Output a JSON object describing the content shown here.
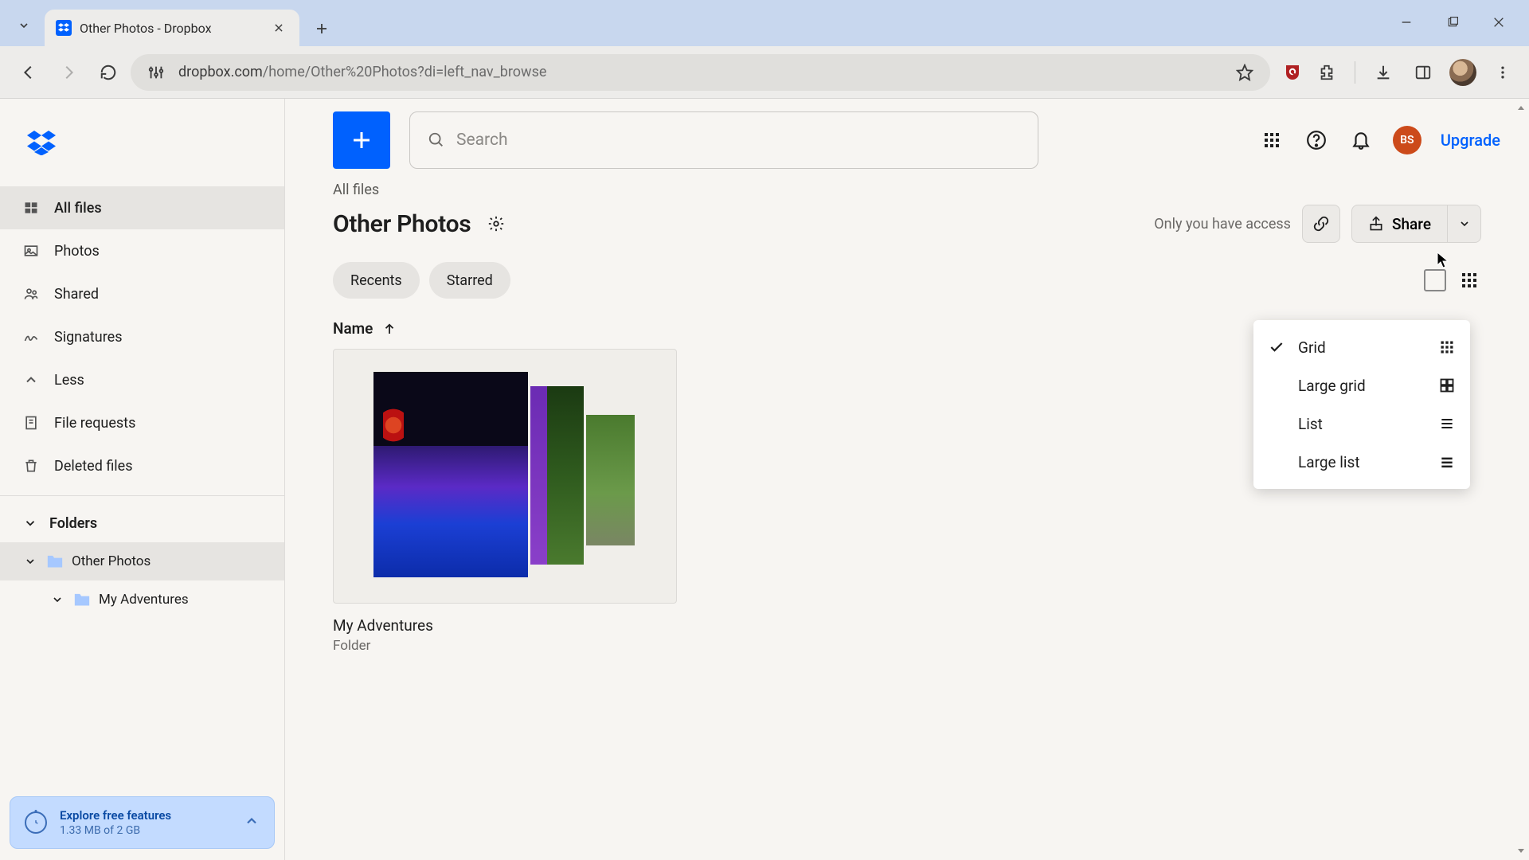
{
  "browser": {
    "tab_title": "Other Photos - Dropbox",
    "url_host": "dropbox.com",
    "url_path": "/home/Other%20Photos?di=left_nav_browse"
  },
  "sidebar": {
    "nav": [
      {
        "id": "all-files",
        "label": "All files",
        "active": true
      },
      {
        "id": "photos",
        "label": "Photos"
      },
      {
        "id": "shared",
        "label": "Shared"
      },
      {
        "id": "signatures",
        "label": "Signatures"
      },
      {
        "id": "less",
        "label": "Less"
      },
      {
        "id": "file-requests",
        "label": "File requests"
      },
      {
        "id": "deleted-files",
        "label": "Deleted files"
      }
    ],
    "folders_header": "Folders",
    "folders": [
      {
        "id": "other-photos",
        "label": "Other Photos",
        "depth": 0,
        "expanded": true,
        "active": true
      },
      {
        "id": "my-adventures",
        "label": "My Adventures",
        "depth": 1,
        "expanded": true
      }
    ],
    "storage": {
      "title": "Explore free features",
      "usage": "1.33 MB of 2 GB"
    }
  },
  "topbar": {
    "search_placeholder": "Search",
    "avatar_initials": "BS",
    "upgrade_label": "Upgrade"
  },
  "page": {
    "breadcrumb": "All files",
    "title": "Other Photos",
    "access_text": "Only you have access",
    "share_label": "Share",
    "filters": {
      "recents": "Recents",
      "starred": "Starred"
    },
    "sort_column": "Name"
  },
  "items": [
    {
      "name": "My Adventures",
      "type_label": "Folder"
    }
  ],
  "view_menu": {
    "options": [
      {
        "id": "grid",
        "label": "Grid",
        "selected": true
      },
      {
        "id": "large-grid",
        "label": "Large grid"
      },
      {
        "id": "list",
        "label": "List"
      },
      {
        "id": "large-list",
        "label": "Large list"
      }
    ]
  }
}
